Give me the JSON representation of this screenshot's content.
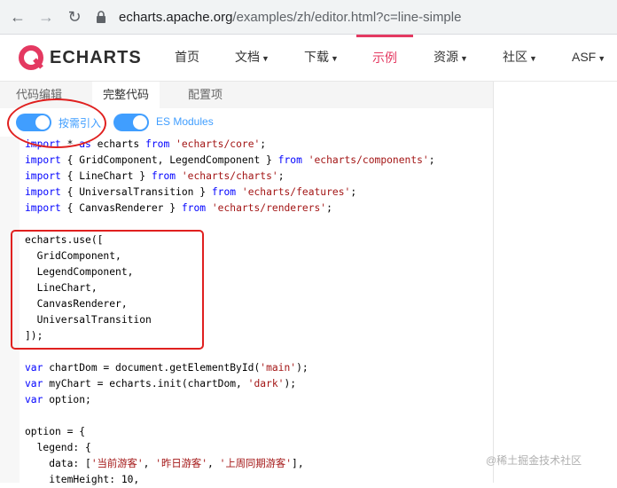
{
  "browser": {
    "url_host": "echarts.apache.org",
    "url_path": "/examples/zh/editor.html?c=line-simple"
  },
  "header": {
    "logo_text": "ECHARTS",
    "menu": [
      {
        "label": "首页"
      },
      {
        "label": "文档"
      },
      {
        "label": "下载"
      },
      {
        "label": "示例"
      },
      {
        "label": "资源"
      },
      {
        "label": "社区"
      },
      {
        "label": "ASF"
      }
    ]
  },
  "tabs": [
    {
      "label": "代码编辑"
    },
    {
      "label": "完整代码"
    },
    {
      "label": "配置项"
    }
  ],
  "toolbar": {
    "toggle1_label": "按需引入",
    "toggle2_label": "ES Modules"
  },
  "code_lines": [
    "import * as echarts from 'echarts/core';",
    "import { GridComponent, LegendComponent } from 'echarts/components';",
    "import { LineChart } from 'echarts/charts';",
    "import { UniversalTransition } from 'echarts/features';",
    "import { CanvasRenderer } from 'echarts/renderers';",
    "",
    "echarts.use([",
    "  GridComponent,",
    "  LegendComponent,",
    "  LineChart,",
    "  CanvasRenderer,",
    "  UniversalTransition",
    "]);",
    "",
    "var chartDom = document.getElementById('main');",
    "var myChart = echarts.init(chartDom, 'dark');",
    "var option;",
    "",
    "option = {",
    "  legend: {",
    "    data: ['当前游客', '昨日游客', '上周同期游客'],",
    "    itemHeight: 10,"
  ],
  "watermark": "@稀土掘金技术社区",
  "colors": {
    "accent": "#e43961",
    "toggle": "#409eff",
    "annotation": "#e0201f"
  }
}
